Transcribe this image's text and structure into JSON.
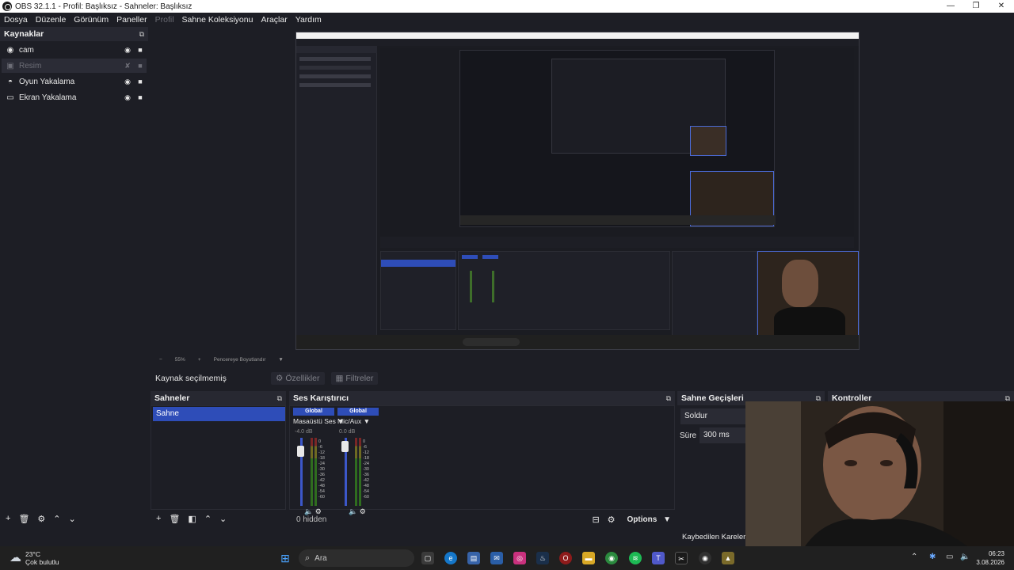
{
  "window": {
    "title": "OBS 32.1.1 - Profil: Başlıksız - Sahneler: Başlıksız",
    "controls": [
      "—",
      "❐",
      "✕"
    ]
  },
  "menu": {
    "items": [
      "Dosya",
      "Düzenle",
      "Görünüm",
      "Paneller",
      "Profil",
      "Sahne Koleksiyonu",
      "Araçlar",
      "Yardım"
    ]
  },
  "sources": {
    "title": "Kaynaklar",
    "items": [
      {
        "label": "cam",
        "icon": "camera-icon"
      },
      {
        "label": "Resim",
        "icon": "image-icon"
      },
      {
        "label": "Oyun Yakalama",
        "icon": "gamepad-icon"
      },
      {
        "label": "Ekran Yakalama",
        "icon": "monitor-icon"
      }
    ]
  },
  "preview": {
    "zoom": "55%",
    "fit_label": "Pencereye Boyutlandır"
  },
  "context": {
    "no_selection": "Kaynak seçilmemiş",
    "properties": "Özellikler",
    "filters": "Filtreler"
  },
  "scenes": {
    "title": "Sahneler",
    "items": [
      "Sahne"
    ]
  },
  "mixer": {
    "title": "Ses Karıştırıcı",
    "channels": [
      {
        "badge": "Global",
        "name": "Masaüstü Ses",
        "db": "-4.0 dB"
      },
      {
        "badge": "Global",
        "name": "Mic/Aux",
        "db": "0.0 dB"
      }
    ],
    "ticks": [
      "0",
      "-6",
      "-12",
      "-18",
      "-24",
      "-30",
      "-36",
      "-42",
      "-48",
      "-54",
      "-60"
    ],
    "hidden": "0 hidden",
    "options": "Options"
  },
  "transitions": {
    "title": "Sahne Geçişleri",
    "type": "Soldur",
    "duration_label": "Süre",
    "duration_value": "300 ms"
  },
  "controls": {
    "title": "Kontroller"
  },
  "status": {
    "dropped": "Kaybedilen Kareler 0"
  },
  "taskbar": {
    "temp": "23°C",
    "weather": "Çok bulutlu",
    "search_placeholder": "Ara",
    "time": "06:23",
    "date": "3.08.2026"
  }
}
